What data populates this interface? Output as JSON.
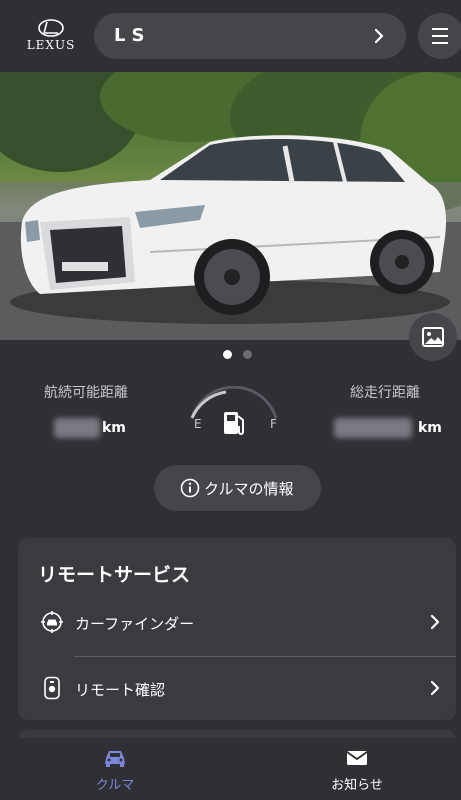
{
  "header": {
    "brand": "LEXUS",
    "model": "LS",
    "chevron_icon": "chevron-right-icon",
    "menu_icon": "hamburger-menu-icon"
  },
  "hero": {
    "image": "white Lexus LS sedan photo",
    "gallery_icon": "image-gallery-icon",
    "pagination": {
      "count": 2,
      "active_index": 0
    }
  },
  "stats": {
    "range_label": "航続可能距離",
    "range_unit": "km",
    "odometer_label": "総走行距離",
    "odometer_unit": "km",
    "gauge_empty": "E",
    "gauge_full": "F"
  },
  "info_button": {
    "label": "クルマの情報",
    "icon": "info-icon"
  },
  "remote": {
    "title": "リモートサービス",
    "items": [
      {
        "label": "カーファインダー",
        "icon": "car-finder-icon"
      },
      {
        "label": "リモート確認",
        "icon": "remote-key-icon"
      }
    ]
  },
  "tabs": [
    {
      "label": "クルマ",
      "icon": "car-icon",
      "active": true
    },
    {
      "label": "お知らせ",
      "icon": "envelope-icon",
      "active": false
    }
  ],
  "colors": {
    "background": "#2f2f35",
    "surface": "#45454c",
    "card": "#3a3a41",
    "active_tab": "#7b86d6",
    "muted_text": "#c8c8cc"
  }
}
